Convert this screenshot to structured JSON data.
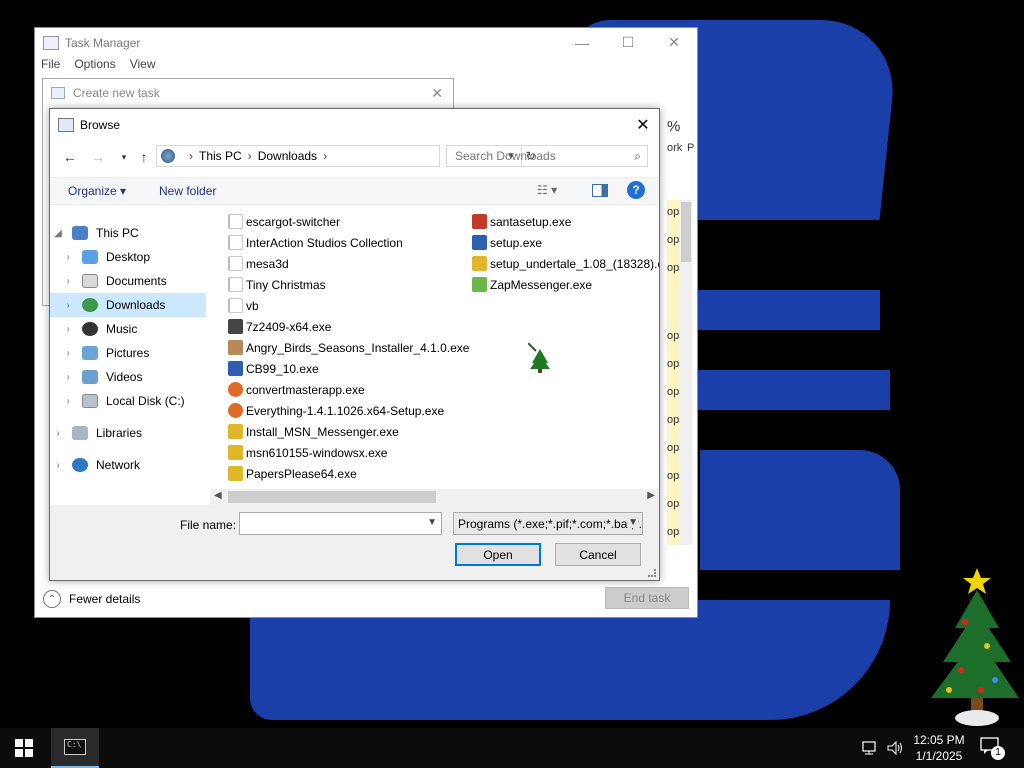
{
  "taskmanager": {
    "title": "Task Manager",
    "menu": [
      "File",
      "Options",
      "View"
    ],
    "controls": {
      "minimize": "—",
      "maximize": "☐",
      "close": "✕"
    },
    "col_percent": "%",
    "col_network": "ork",
    "col_p": "P",
    "ops_label": "ops",
    "fewer_details": "Fewer details",
    "end_task": "End task"
  },
  "createtask": {
    "title": "Create new task"
  },
  "browse": {
    "title": "Browse",
    "close": "✕",
    "address": {
      "root": "This PC",
      "folder": "Downloads"
    },
    "search_placeholder": "Search Downloads",
    "toolbar": {
      "organize": "Organize ▾",
      "new_folder": "New folder",
      "help": "?"
    },
    "nav": [
      {
        "label": "This PC",
        "icon": "computer-icon"
      },
      {
        "label": "Desktop",
        "icon": "desktop-icon"
      },
      {
        "label": "Documents",
        "icon": "documents-icon"
      },
      {
        "label": "Downloads",
        "icon": "downloads-icon"
      },
      {
        "label": "Music",
        "icon": "music-icon"
      },
      {
        "label": "Pictures",
        "icon": "pictures-icon"
      },
      {
        "label": "Videos",
        "icon": "videos-icon"
      },
      {
        "label": "Local Disk (C:)",
        "icon": "disk-icon"
      },
      {
        "label": "Libraries",
        "icon": "libraries-icon"
      },
      {
        "label": "Network",
        "icon": "network-icon"
      }
    ],
    "files_col1": [
      {
        "name": "escargot-switcher",
        "icon": "folder-icon"
      },
      {
        "name": "InterAction Studios Collection",
        "icon": "folder-icon"
      },
      {
        "name": "mesa3d",
        "icon": "folder-icon"
      },
      {
        "name": "Tiny Christmas",
        "icon": "folder-icon"
      },
      {
        "name": "vb",
        "icon": "folder-icon"
      },
      {
        "name": "7z2409-x64.exe",
        "icon": "7zip-icon"
      },
      {
        "name": "Angry_Birds_Seasons_Installer_4.1.0.exe",
        "icon": "angry-birds-icon"
      },
      {
        "name": "CB99_10.exe",
        "icon": "installer-icon"
      },
      {
        "name": "convertmasterapp.exe",
        "icon": "convertmaster-icon"
      },
      {
        "name": "Everything-1.4.1.1026.x64-Setup.exe",
        "icon": "everything-icon"
      },
      {
        "name": "Install_MSN_Messenger.exe",
        "icon": "msn-installer-icon"
      },
      {
        "name": "msn610155-windowsx.exe",
        "icon": "msn-installer-icon"
      },
      {
        "name": "PapersPlease64.exe",
        "icon": "papers-please-icon"
      }
    ],
    "files_col2": [
      {
        "name": "santasetup.exe",
        "icon": "santa-icon"
      },
      {
        "name": "setup.exe",
        "icon": "setup-icon"
      },
      {
        "name": "setup_undertale_1.08_(18328).exe",
        "icon": "undertale-icon"
      },
      {
        "name": "ZapMessenger.exe",
        "icon": "zapmessenger-icon"
      }
    ],
    "footer": {
      "file_name_label": "File name:",
      "file_name_value": "",
      "file_type": "Programs (*.exe;*.pif;*.com;*.bat;*.cmd)",
      "open": "Open",
      "cancel": "Cancel"
    }
  },
  "taskbar": {
    "time": "12:05 PM",
    "date": "1/1/2025",
    "notification_count": "1"
  },
  "colors": {
    "accent": "#0078d7",
    "selection": "#cce8ff",
    "wallpaper_blue": "#1a3fa8"
  }
}
